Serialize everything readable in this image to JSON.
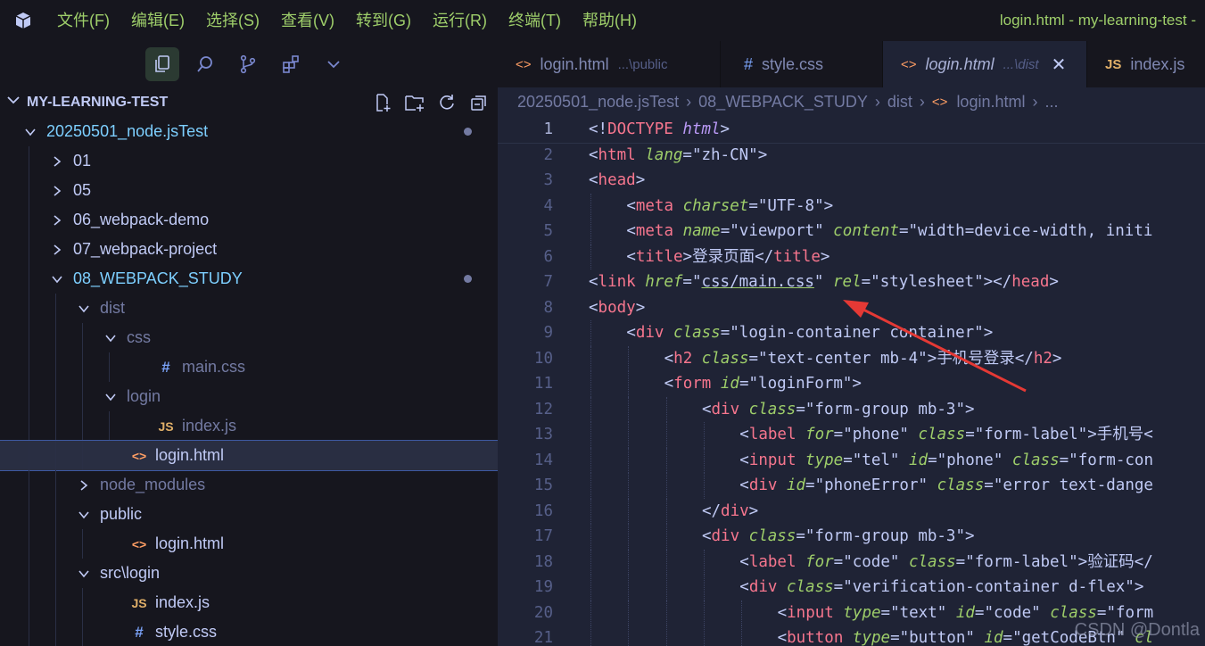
{
  "menubar": {
    "items": [
      "文件(F)",
      "编辑(E)",
      "选择(S)",
      "查看(V)",
      "转到(G)",
      "运行(R)",
      "终端(T)",
      "帮助(H)"
    ],
    "window_title": "login.html - my-learning-test -"
  },
  "tabs": [
    {
      "icon": "html-icon",
      "label": "login.html",
      "description": "...\\public",
      "active": false
    },
    {
      "icon": "css-icon",
      "label": "style.css",
      "description": "",
      "active": false
    },
    {
      "icon": "html-icon",
      "label": "login.html",
      "description": "...\\dist",
      "active": true
    },
    {
      "icon": "js-icon",
      "label": "index.js",
      "description": "",
      "active": false
    }
  ],
  "explorer": {
    "title": "MY-LEARNING-TEST",
    "tree": [
      {
        "label": "20250501_node.jsTest",
        "depth": 0,
        "twisty": "open",
        "icon": "",
        "color": "cyan",
        "dot": true
      },
      {
        "label": "01",
        "depth": 1,
        "twisty": "closed",
        "icon": "",
        "color": "",
        "dot": false
      },
      {
        "label": "05",
        "depth": 1,
        "twisty": "closed",
        "icon": "",
        "color": "",
        "dot": false
      },
      {
        "label": "06_webpack-demo",
        "depth": 1,
        "twisty": "closed",
        "icon": "",
        "color": "",
        "dot": false
      },
      {
        "label": "07_webpack-project",
        "depth": 1,
        "twisty": "closed",
        "icon": "",
        "color": "",
        "dot": false
      },
      {
        "label": "08_WEBPACK_STUDY",
        "depth": 1,
        "twisty": "open",
        "icon": "",
        "color": "cyan",
        "dot": true
      },
      {
        "label": "dist",
        "depth": 2,
        "twisty": "open",
        "icon": "",
        "color": "dim",
        "dot": false
      },
      {
        "label": "css",
        "depth": 3,
        "twisty": "open",
        "icon": "",
        "color": "dim",
        "dot": false
      },
      {
        "label": "main.css",
        "depth": 4,
        "twisty": "",
        "icon": "css",
        "color": "dim",
        "dot": false
      },
      {
        "label": "login",
        "depth": 3,
        "twisty": "open",
        "icon": "",
        "color": "dim",
        "dot": false
      },
      {
        "label": "index.js",
        "depth": 4,
        "twisty": "",
        "icon": "js",
        "color": "dim",
        "dot": false
      },
      {
        "label": "login.html",
        "depth": 3,
        "twisty": "",
        "icon": "html",
        "color": "",
        "dot": false,
        "selected": true
      },
      {
        "label": "node_modules",
        "depth": 2,
        "twisty": "closed",
        "icon": "",
        "color": "dim",
        "dot": false
      },
      {
        "label": "public",
        "depth": 2,
        "twisty": "open",
        "icon": "",
        "color": "",
        "dot": false
      },
      {
        "label": "login.html",
        "depth": 3,
        "twisty": "",
        "icon": "html",
        "color": "",
        "dot": false
      },
      {
        "label": "src\\login",
        "depth": 2,
        "twisty": "open",
        "icon": "",
        "color": "",
        "dot": false
      },
      {
        "label": "index.js",
        "depth": 3,
        "twisty": "",
        "icon": "js",
        "color": "",
        "dot": false
      },
      {
        "label": "style.css",
        "depth": 3,
        "twisty": "",
        "icon": "css",
        "color": "",
        "dot": false
      }
    ]
  },
  "breadcrumb": [
    "20250501_node.jsTest",
    "08_WEBPACK_STUDY",
    "dist",
    "login.html",
    "..."
  ],
  "editor": {
    "current_line": 1,
    "lines": [
      {
        "n": 1,
        "indent": 0,
        "tokens": [
          [
            "br",
            "<!"
          ],
          [
            "tag",
            "DOCTYPE"
          ],
          [
            "br",
            " "
          ],
          [
            "kw",
            "html"
          ],
          [
            "br",
            ">"
          ]
        ]
      },
      {
        "n": 2,
        "indent": 0,
        "tokens": [
          [
            "br",
            "<"
          ],
          [
            "tag",
            "html"
          ],
          [
            "br",
            " "
          ],
          [
            "attr",
            "lang"
          ],
          [
            "br",
            "="
          ],
          [
            "str",
            "\"zh-CN\""
          ],
          [
            "br",
            ">"
          ]
        ]
      },
      {
        "n": 3,
        "indent": 0,
        "tokens": [
          [
            "br",
            "<"
          ],
          [
            "tag",
            "head"
          ],
          [
            "br",
            ">"
          ]
        ]
      },
      {
        "n": 4,
        "indent": 1,
        "tokens": [
          [
            "br",
            "<"
          ],
          [
            "tag",
            "meta"
          ],
          [
            "br",
            " "
          ],
          [
            "attr",
            "charset"
          ],
          [
            "br",
            "="
          ],
          [
            "str",
            "\"UTF-8\""
          ],
          [
            "br",
            ">"
          ]
        ]
      },
      {
        "n": 5,
        "indent": 1,
        "tokens": [
          [
            "br",
            "<"
          ],
          [
            "tag",
            "meta"
          ],
          [
            "br",
            " "
          ],
          [
            "attr",
            "name"
          ],
          [
            "br",
            "="
          ],
          [
            "str",
            "\"viewport\""
          ],
          [
            "br",
            " "
          ],
          [
            "attr",
            "content"
          ],
          [
            "br",
            "="
          ],
          [
            "str",
            "\"width=device-width, initi"
          ]
        ]
      },
      {
        "n": 6,
        "indent": 1,
        "tokens": [
          [
            "br",
            "<"
          ],
          [
            "tag",
            "title"
          ],
          [
            "br",
            ">"
          ],
          [
            "txt",
            "登录页面"
          ],
          [
            "br",
            "</"
          ],
          [
            "tag",
            "title"
          ],
          [
            "br",
            ">"
          ]
        ]
      },
      {
        "n": 7,
        "indent": 0,
        "tokens": [
          [
            "br",
            "<"
          ],
          [
            "tag",
            "link"
          ],
          [
            "br",
            " "
          ],
          [
            "attr",
            "href"
          ],
          [
            "br",
            "=\""
          ],
          [
            "under",
            "css/main.css"
          ],
          [
            "br",
            "\""
          ],
          [
            "br",
            " "
          ],
          [
            "attr",
            "rel"
          ],
          [
            "br",
            "="
          ],
          [
            "str",
            "\"stylesheet\""
          ],
          [
            "br",
            "></"
          ],
          [
            "tag",
            "head"
          ],
          [
            "br",
            ">"
          ]
        ]
      },
      {
        "n": 8,
        "indent": 0,
        "tokens": [
          [
            "br",
            "<"
          ],
          [
            "tag",
            "body"
          ],
          [
            "br",
            ">"
          ]
        ]
      },
      {
        "n": 9,
        "indent": 1,
        "tokens": [
          [
            "br",
            "<"
          ],
          [
            "tag",
            "div"
          ],
          [
            "br",
            " "
          ],
          [
            "attr2",
            "class"
          ],
          [
            "br",
            "="
          ],
          [
            "str",
            "\"login-container container\""
          ],
          [
            "br",
            ">"
          ]
        ]
      },
      {
        "n": 10,
        "indent": 2,
        "tokens": [
          [
            "br",
            "<"
          ],
          [
            "tag",
            "h2"
          ],
          [
            "br",
            " "
          ],
          [
            "attr2",
            "class"
          ],
          [
            "br",
            "="
          ],
          [
            "str",
            "\"text-center mb-4\""
          ],
          [
            "br",
            ">"
          ],
          [
            "txt",
            "手机号登录"
          ],
          [
            "br",
            "</"
          ],
          [
            "tag",
            "h2"
          ],
          [
            "br",
            ">"
          ]
        ]
      },
      {
        "n": 11,
        "indent": 2,
        "tokens": [
          [
            "br",
            "<"
          ],
          [
            "tag",
            "form"
          ],
          [
            "br",
            " "
          ],
          [
            "attr",
            "id"
          ],
          [
            "br",
            "="
          ],
          [
            "str",
            "\"loginForm\""
          ],
          [
            "br",
            ">"
          ]
        ]
      },
      {
        "n": 12,
        "indent": 3,
        "tokens": [
          [
            "br",
            "<"
          ],
          [
            "tag",
            "div"
          ],
          [
            "br",
            " "
          ],
          [
            "attr2",
            "class"
          ],
          [
            "br",
            "="
          ],
          [
            "str",
            "\"form-group mb-3\""
          ],
          [
            "br",
            ">"
          ]
        ]
      },
      {
        "n": 13,
        "indent": 4,
        "tokens": [
          [
            "br",
            "<"
          ],
          [
            "tag",
            "label"
          ],
          [
            "br",
            " "
          ],
          [
            "attr",
            "for"
          ],
          [
            "br",
            "="
          ],
          [
            "str",
            "\"phone\""
          ],
          [
            "br",
            " "
          ],
          [
            "attr2",
            "class"
          ],
          [
            "br",
            "="
          ],
          [
            "str",
            "\"form-label\""
          ],
          [
            "br",
            ">"
          ],
          [
            "txt",
            "手机号<"
          ]
        ]
      },
      {
        "n": 14,
        "indent": 4,
        "tokens": [
          [
            "br",
            "<"
          ],
          [
            "tag",
            "input"
          ],
          [
            "br",
            " "
          ],
          [
            "attr",
            "type"
          ],
          [
            "br",
            "="
          ],
          [
            "str",
            "\"tel\""
          ],
          [
            "br",
            " "
          ],
          [
            "attr",
            "id"
          ],
          [
            "br",
            "="
          ],
          [
            "str",
            "\"phone\""
          ],
          [
            "br",
            " "
          ],
          [
            "attr2",
            "class"
          ],
          [
            "br",
            "="
          ],
          [
            "str",
            "\"form-con"
          ]
        ]
      },
      {
        "n": 15,
        "indent": 4,
        "tokens": [
          [
            "br",
            "<"
          ],
          [
            "tag",
            "div"
          ],
          [
            "br",
            " "
          ],
          [
            "attr",
            "id"
          ],
          [
            "br",
            "="
          ],
          [
            "str",
            "\"phoneError\""
          ],
          [
            "br",
            " "
          ],
          [
            "attr2",
            "class"
          ],
          [
            "br",
            "="
          ],
          [
            "str",
            "\"error text-dange"
          ]
        ]
      },
      {
        "n": 16,
        "indent": 3,
        "tokens": [
          [
            "br",
            "</"
          ],
          [
            "tag",
            "div"
          ],
          [
            "br",
            ">"
          ]
        ]
      },
      {
        "n": 17,
        "indent": 3,
        "tokens": [
          [
            "br",
            "<"
          ],
          [
            "tag",
            "div"
          ],
          [
            "br",
            " "
          ],
          [
            "attr2",
            "class"
          ],
          [
            "br",
            "="
          ],
          [
            "str",
            "\"form-group mb-3\""
          ],
          [
            "br",
            ">"
          ]
        ]
      },
      {
        "n": 18,
        "indent": 4,
        "tokens": [
          [
            "br",
            "<"
          ],
          [
            "tag",
            "label"
          ],
          [
            "br",
            " "
          ],
          [
            "attr",
            "for"
          ],
          [
            "br",
            "="
          ],
          [
            "str",
            "\"code\""
          ],
          [
            "br",
            " "
          ],
          [
            "attr2",
            "class"
          ],
          [
            "br",
            "="
          ],
          [
            "str",
            "\"form-label\""
          ],
          [
            "br",
            ">"
          ],
          [
            "txt",
            "验证码</"
          ]
        ]
      },
      {
        "n": 19,
        "indent": 4,
        "tokens": [
          [
            "br",
            "<"
          ],
          [
            "tag",
            "div"
          ],
          [
            "br",
            " "
          ],
          [
            "attr2",
            "class"
          ],
          [
            "br",
            "="
          ],
          [
            "str",
            "\"verification-container d-flex\""
          ],
          [
            "br",
            ">"
          ]
        ]
      },
      {
        "n": 20,
        "indent": 5,
        "tokens": [
          [
            "br",
            "<"
          ],
          [
            "tag",
            "input"
          ],
          [
            "br",
            " "
          ],
          [
            "attr",
            "type"
          ],
          [
            "br",
            "="
          ],
          [
            "str",
            "\"text\""
          ],
          [
            "br",
            " "
          ],
          [
            "attr",
            "id"
          ],
          [
            "br",
            "="
          ],
          [
            "str",
            "\"code\""
          ],
          [
            "br",
            " "
          ],
          [
            "attr2",
            "class"
          ],
          [
            "br",
            "="
          ],
          [
            "str",
            "\"form"
          ]
        ]
      },
      {
        "n": 21,
        "indent": 5,
        "tokens": [
          [
            "br",
            "<"
          ],
          [
            "tag",
            "button"
          ],
          [
            "br",
            " "
          ],
          [
            "attr",
            "type"
          ],
          [
            "br",
            "="
          ],
          [
            "str",
            "\"button\""
          ],
          [
            "br",
            " "
          ],
          [
            "attr",
            "id"
          ],
          [
            "br",
            "="
          ],
          [
            "str",
            "\"getCodeBtn\""
          ],
          [
            "br",
            " "
          ],
          [
            "attr2",
            "cl"
          ]
        ]
      }
    ]
  },
  "watermark": "CSDN @Dontla"
}
